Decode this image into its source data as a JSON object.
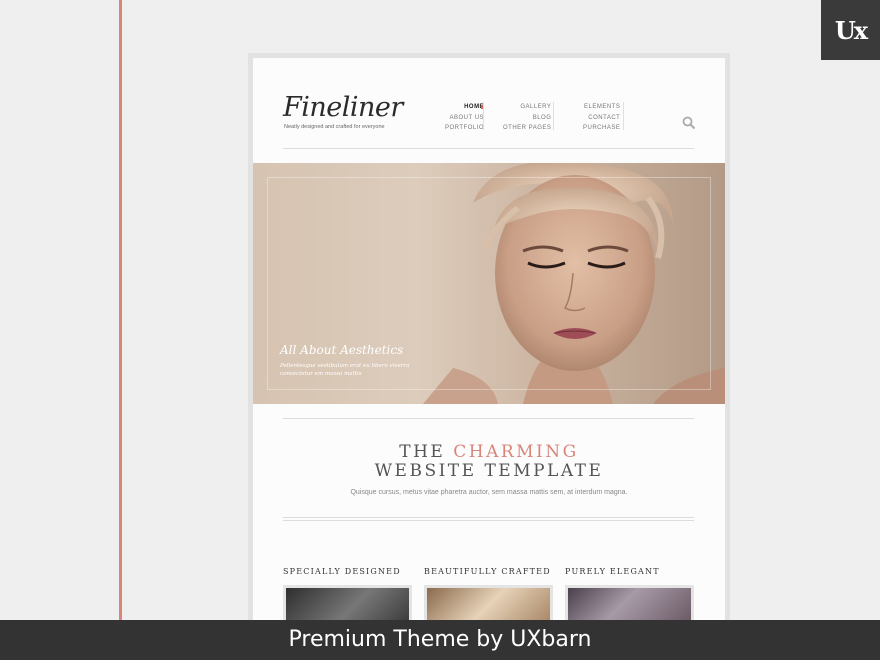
{
  "badge": {
    "text": "Ux"
  },
  "site": {
    "logo": "Fineliner",
    "tagline": "Neatly designed and crafted for everyone"
  },
  "nav": {
    "col1": [
      "HOME",
      "ABOUT US",
      "PORTFOLIO"
    ],
    "col2": [
      "GALLERY",
      "BLOG",
      "OTHER PAGES"
    ],
    "col3": [
      "ELEMENTS",
      "CONTACT",
      "PURCHASE"
    ]
  },
  "hero": {
    "title": "All About Aesthetics",
    "text": "Pellentesque vestibulum erat eu libero viverra consectetur em massa mattis"
  },
  "headline": {
    "line1_a": "THE ",
    "line1_b": "CHARMING",
    "line2": "WEBSITE TEMPLATE",
    "sub": "Quisque cursus, metus vitae pharetra auctor, sem massa mattis sem, at interdum magna."
  },
  "features": [
    {
      "title": "SPECIALLY DESIGNED"
    },
    {
      "title": "BEAUTIFULLY CRAFTED"
    },
    {
      "title": "PURELY ELEGANT"
    }
  ],
  "footer": {
    "text": "Premium Theme by UXbarn"
  },
  "colors": {
    "accent": "#d9857a",
    "footer_bg": "#333333",
    "badge_bg": "#3a3a3a"
  }
}
